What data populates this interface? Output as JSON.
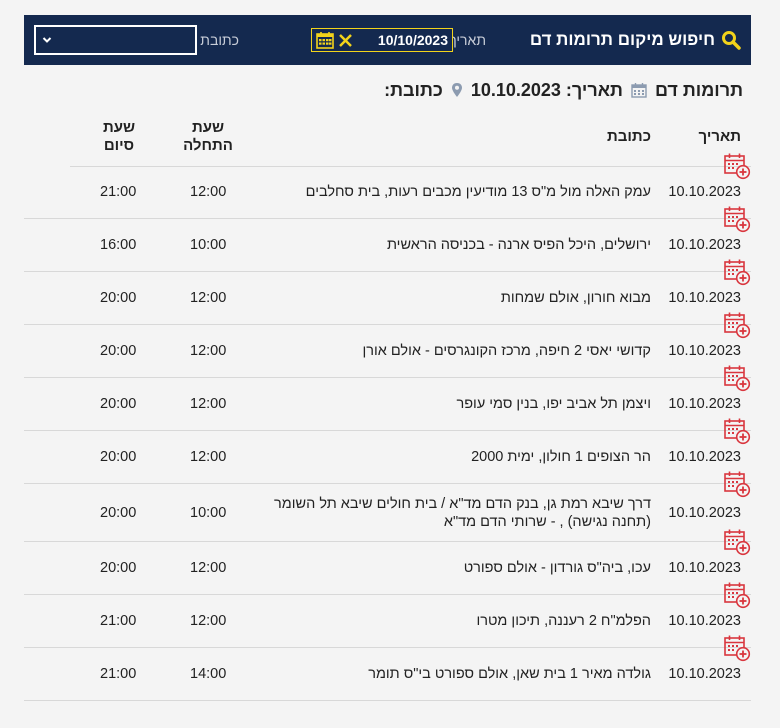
{
  "topbar": {
    "title": "חיפוש מיקום תרומות דם",
    "date_label": "תאריך",
    "date_value": "10/10/2023",
    "address_label": "כתובת",
    "accent_color": "#f2d31b",
    "bg_color": "#14294f"
  },
  "subheader": {
    "section": "תרומות דם",
    "date_text": "תאריך: 10.10.2023",
    "address_text": "כתובת:"
  },
  "table": {
    "headers": {
      "date": "תאריך",
      "address": "כתובת",
      "start_line1": "שעת",
      "start_line2": "התחלה",
      "end_line1": "שעת",
      "end_line2": "סיום"
    },
    "rows": [
      {
        "date": "10.10.2023",
        "address": "עמק האלה מול מ\"ס 13 מודיעין מכבים רעות, בית סחלבים",
        "start": "12:00",
        "end": "21:00"
      },
      {
        "date": "10.10.2023",
        "address": "ירושלים, היכל הפיס ארנה - בכניסה הראשית",
        "start": "10:00",
        "end": "16:00"
      },
      {
        "date": "10.10.2023",
        "address": "מבוא חורון, אולם שמחות",
        "start": "12:00",
        "end": "20:00"
      },
      {
        "date": "10.10.2023",
        "address": "קדושי יאסי 2 חיפה, מרכז הקונגרסים - אולם אורן",
        "start": "12:00",
        "end": "20:00"
      },
      {
        "date": "10.10.2023",
        "address": "ויצמן תל אביב יפו, בנין סמי עופר",
        "start": "12:00",
        "end": "20:00"
      },
      {
        "date": "10.10.2023",
        "address": "הר הצופים 1 חולון, ימית 2000",
        "start": "12:00",
        "end": "20:00"
      },
      {
        "date": "10.10.2023",
        "address": "דרך שיבא רמת גן, בנק הדם מד\"א / בית חולים שיבא תל השומר (תחנה נגישה) , - שרותי הדם מד\"א",
        "start": "10:00",
        "end": "20:00"
      },
      {
        "date": "10.10.2023",
        "address": "עכו, ביה\"ס גורדון - אולם ספורט",
        "start": "12:00",
        "end": "20:00"
      },
      {
        "date": "10.10.2023",
        "address": "הפלמ\"ח 2 רעננה, תיכון מטרו",
        "start": "12:00",
        "end": "21:00"
      },
      {
        "date": "10.10.2023",
        "address": "גולדה מאיר 1 בית שאן, אולם ספורט בי\"ס תומר",
        "start": "14:00",
        "end": "21:00"
      }
    ],
    "row_icon": "calendar-add-icon",
    "icon_color": "#d9363e"
  }
}
